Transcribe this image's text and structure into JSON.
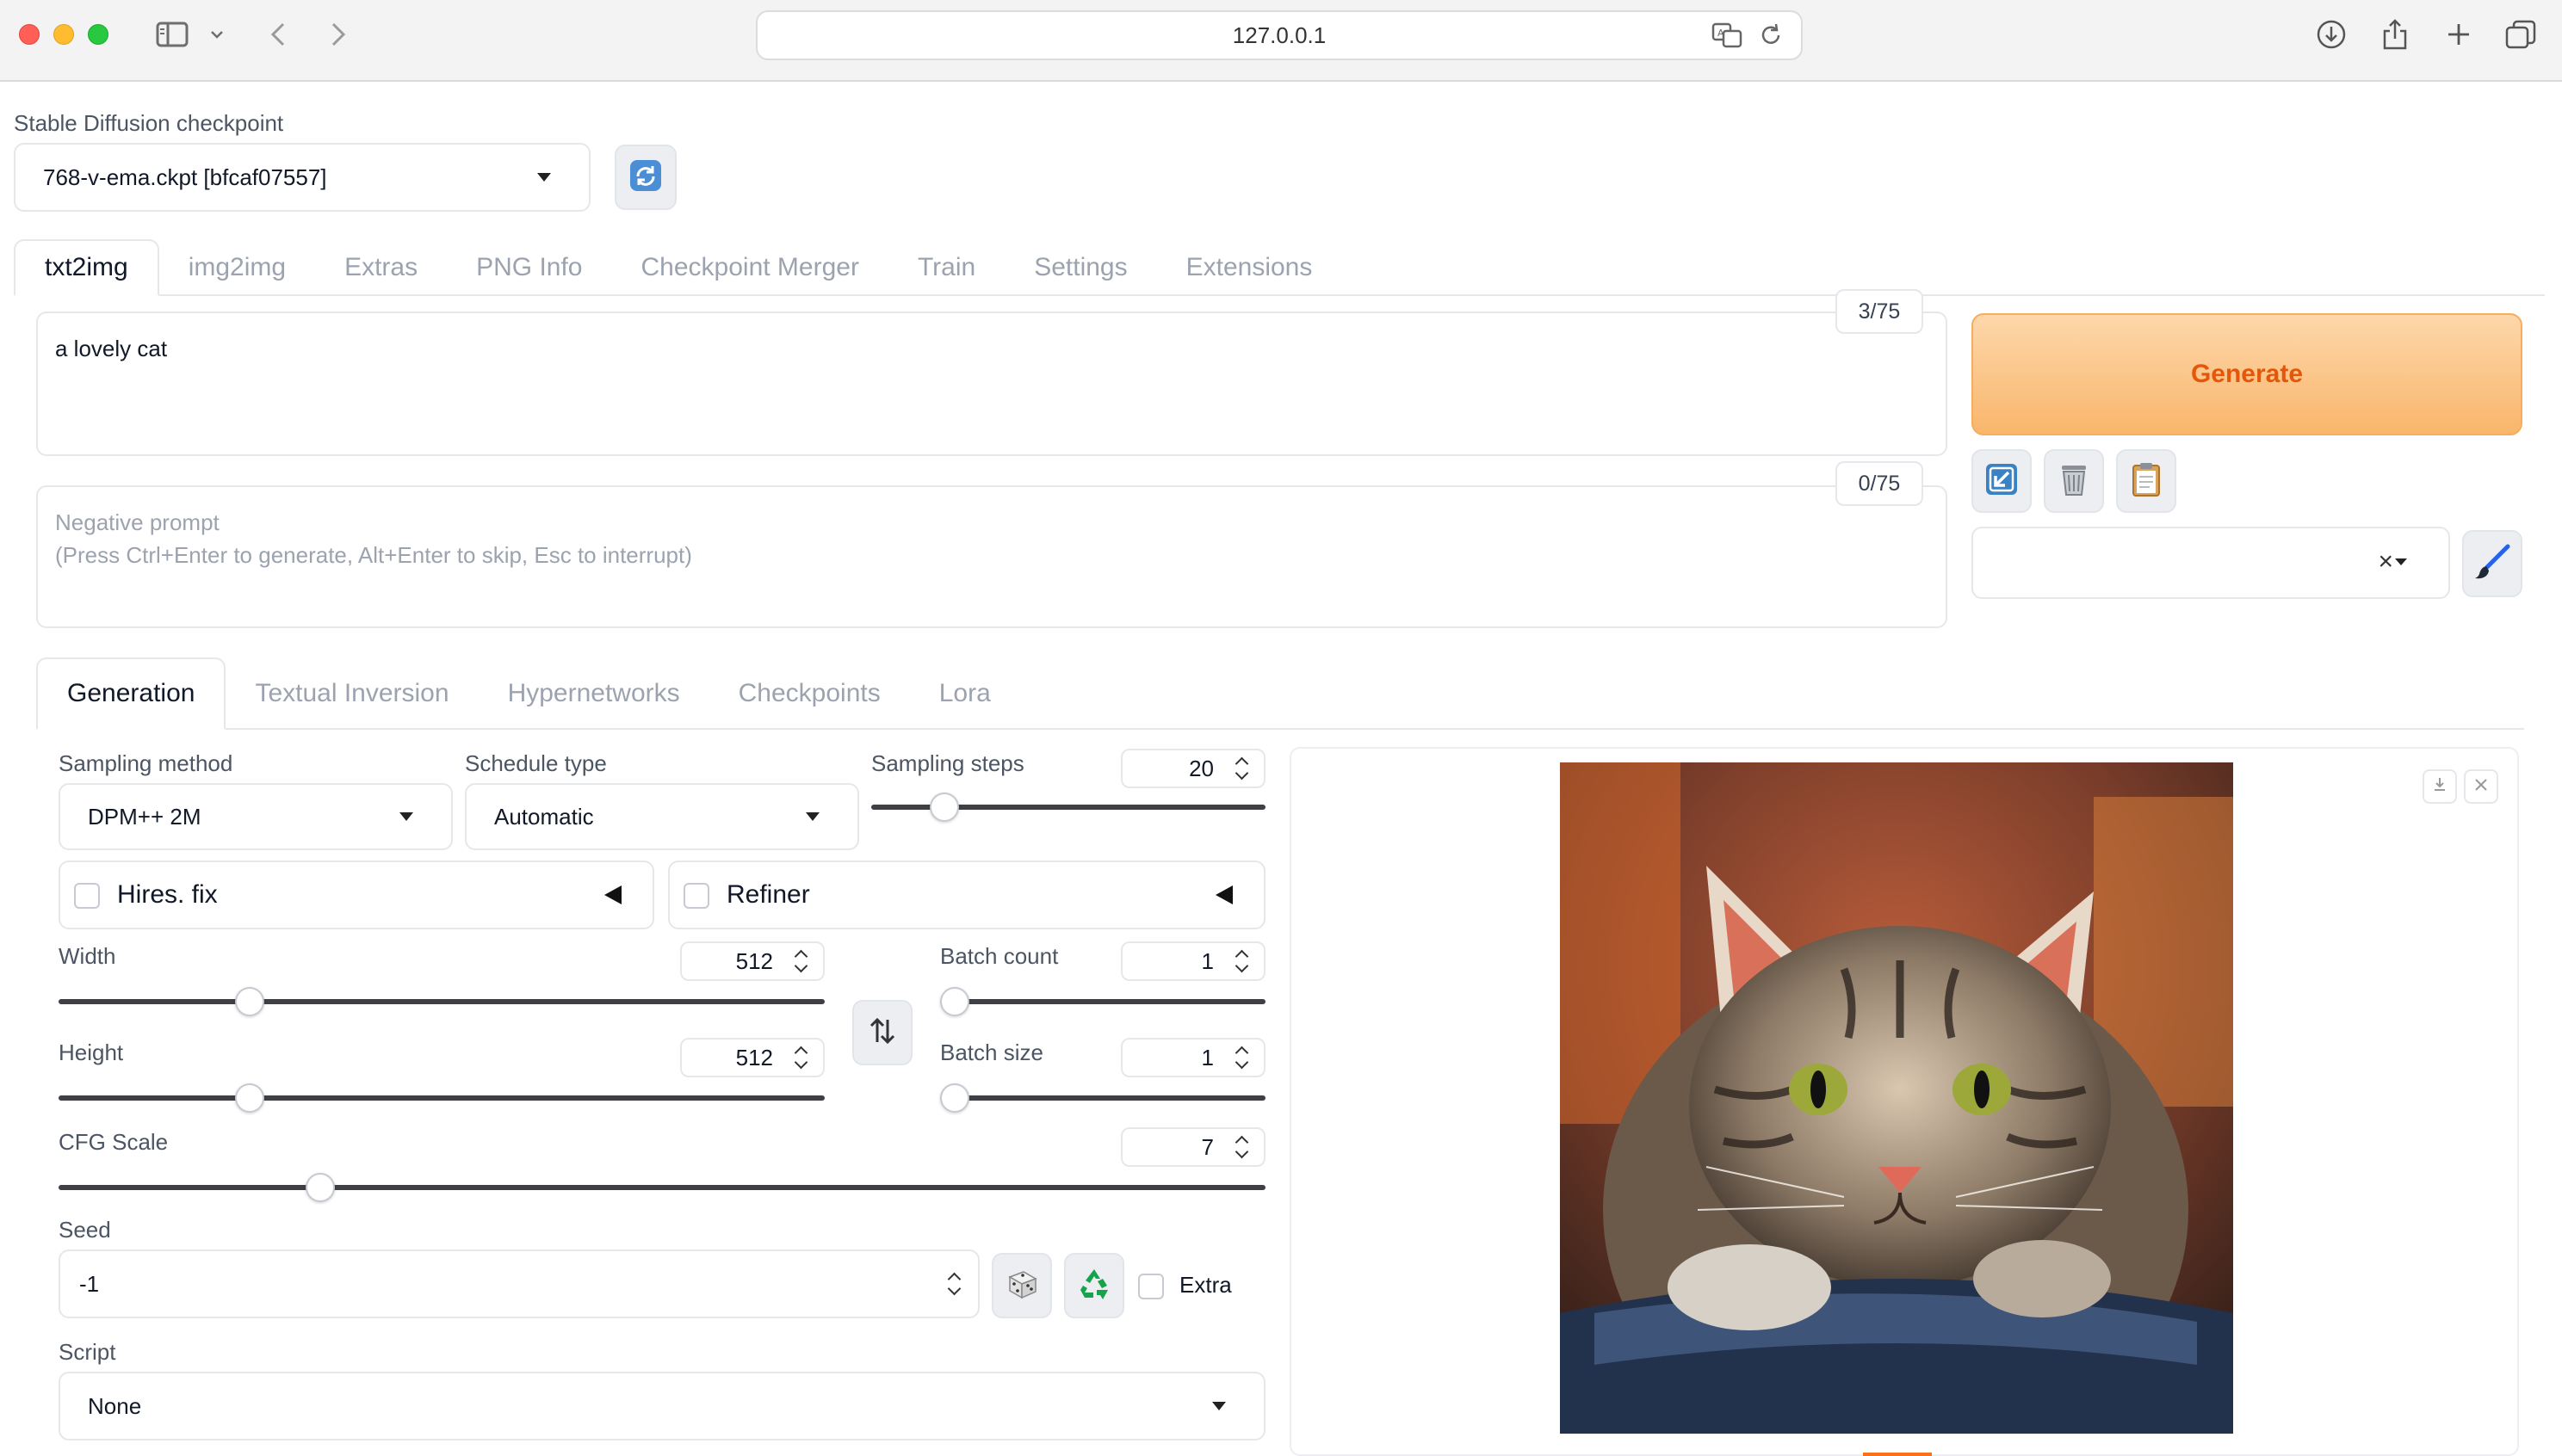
{
  "browser": {
    "url": "127.0.0.1"
  },
  "checkpoint": {
    "label": "Stable Diffusion checkpoint",
    "value": "768-v-ema.ckpt [bfcaf07557]"
  },
  "main_tabs": [
    "txt2img",
    "img2img",
    "Extras",
    "PNG Info",
    "Checkpoint Merger",
    "Train",
    "Settings",
    "Extensions"
  ],
  "prompt": {
    "value": "a lovely cat",
    "counter": "3/75"
  },
  "negative_prompt": {
    "placeholder_line1": "Negative prompt",
    "placeholder_line2": "(Press Ctrl+Enter to generate, Alt+Enter to skip, Esc to interrupt)",
    "counter": "0/75"
  },
  "generate_label": "Generate",
  "styles": {
    "clear_symbol": "×"
  },
  "sub_tabs": [
    "Generation",
    "Textual Inversion",
    "Hypernetworks",
    "Checkpoints",
    "Lora"
  ],
  "sampling": {
    "method_label": "Sampling method",
    "method_value": "DPM++ 2M",
    "schedule_label": "Schedule type",
    "schedule_value": "Automatic",
    "steps_label": "Sampling steps",
    "steps_value": "20",
    "steps_fraction": 0.16
  },
  "hires_label": "Hires. fix",
  "refiner_label": "Refiner",
  "width": {
    "label": "Width",
    "value": "512",
    "fraction": 0.24
  },
  "height": {
    "label": "Height",
    "value": "512",
    "fraction": 0.24
  },
  "batch_count": {
    "label": "Batch count",
    "value": "1",
    "fraction": 0.0
  },
  "batch_size": {
    "label": "Batch size",
    "value": "1",
    "fraction": 0.0
  },
  "cfg": {
    "label": "CFG Scale",
    "value": "7",
    "fraction": 0.21
  },
  "seed": {
    "label": "Seed",
    "value": "-1",
    "extra_label": "Extra"
  },
  "script": {
    "label": "Script",
    "value": "None"
  },
  "colors": {
    "generate_text": "#e4570b",
    "generate_bg": "#f9b66c",
    "recycle_green": "#16a34a"
  },
  "icons": {
    "refresh": "refresh-icon",
    "paste": "arrow-down-left-icon",
    "trash": "trash-icon",
    "clipboard": "clipboard-icon",
    "brush": "paintbrush-icon",
    "dice": "dice-icon",
    "recycle": "recycle-icon",
    "swap": "swap-icon",
    "download": "download-icon",
    "close": "close-icon"
  }
}
